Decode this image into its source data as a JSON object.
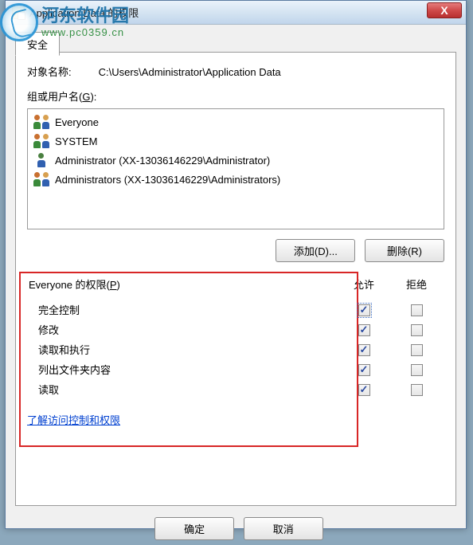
{
  "title": "Application Data 的权限",
  "tab": {
    "label": "安全"
  },
  "object": {
    "label": "对象名称:",
    "path": "C:\\Users\\Administrator\\Application Data"
  },
  "groups": {
    "label_pre": "组或用户名(",
    "label_key": "G",
    "label_post": "):",
    "items": [
      {
        "icon": "two",
        "name": "Everyone"
      },
      {
        "icon": "two",
        "name": "SYSTEM"
      },
      {
        "icon": "single",
        "name": "Administrator (XX-13036146229\\Administrator)"
      },
      {
        "icon": "two",
        "name": "Administrators (XX-13036146229\\Administrators)"
      }
    ]
  },
  "buttons": {
    "add": "添加(D)...",
    "remove": "删除(R)",
    "ok": "确定",
    "cancel": "取消"
  },
  "perm": {
    "title_pre": "Everyone 的权限(",
    "title_key": "P",
    "title_post": ")",
    "col_allow": "允许",
    "col_deny": "拒绝",
    "rows": [
      {
        "name": "完全控制",
        "allow": true,
        "deny": false,
        "focused": true
      },
      {
        "name": "修改",
        "allow": true,
        "deny": false
      },
      {
        "name": "读取和执行",
        "allow": true,
        "deny": false
      },
      {
        "name": "列出文件夹内容",
        "allow": true,
        "deny": false
      },
      {
        "name": "读取",
        "allow": true,
        "deny": false
      }
    ]
  },
  "learn_link": "了解访问控制和权限",
  "watermark": {
    "cn": "河东软件园",
    "url": "www.pc0359.cn"
  }
}
